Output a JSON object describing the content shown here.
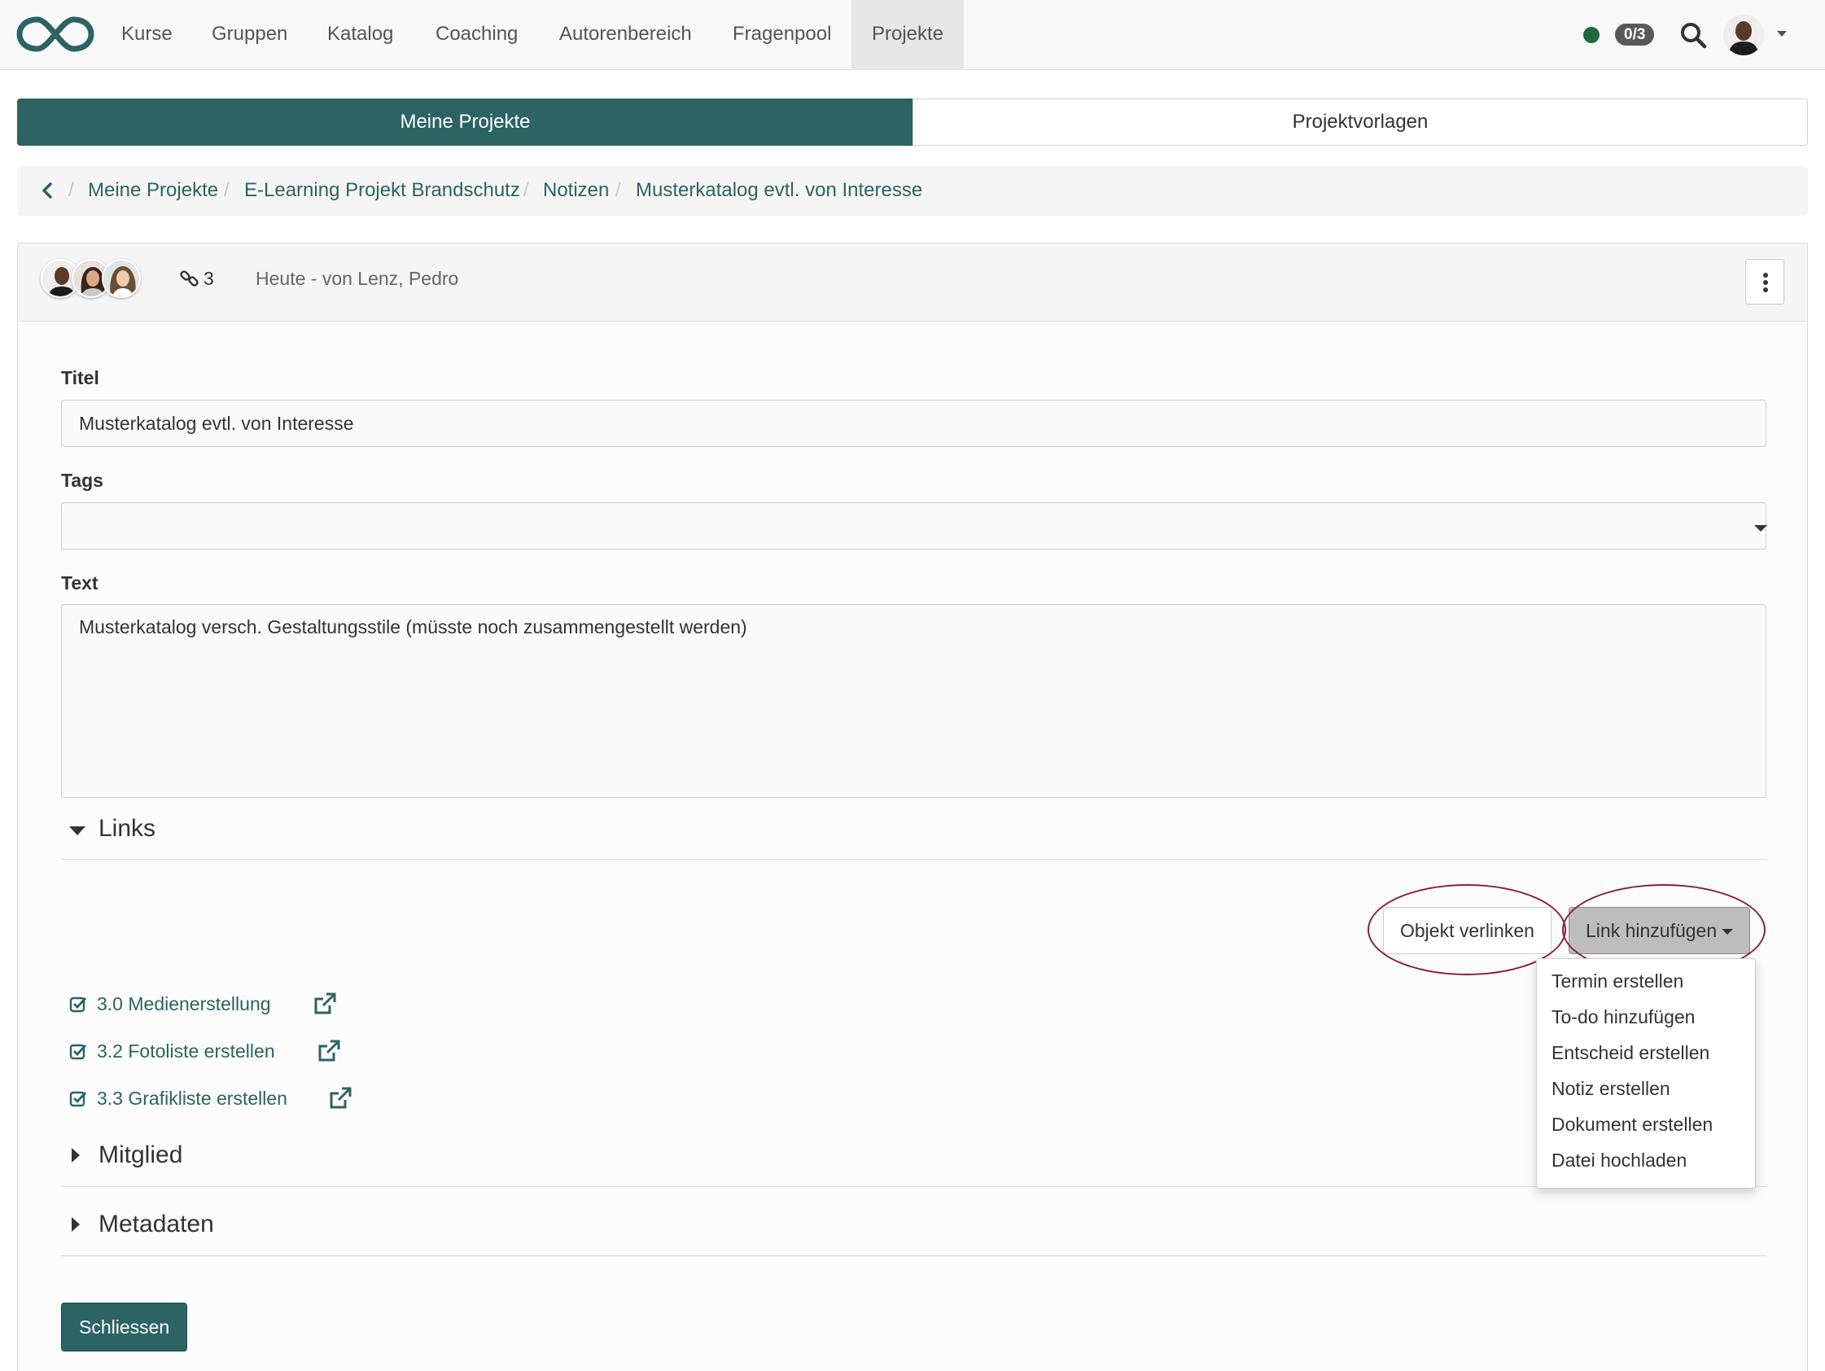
{
  "topnav": {
    "items": [
      {
        "label": "Kurse"
      },
      {
        "label": "Gruppen"
      },
      {
        "label": "Katalog"
      },
      {
        "label": "Coaching"
      },
      {
        "label": "Autorenbereich"
      },
      {
        "label": "Fragenpool"
      },
      {
        "label": "Projekte"
      }
    ],
    "active_item": "Projekte",
    "badge_count": "0/3",
    "status_color": "#1e6a3a"
  },
  "segments": {
    "my_projects": "Meine Projekte",
    "templates": "Projektvorlagen",
    "active": "Meine Projekte"
  },
  "breadcrumb": {
    "items": [
      {
        "label": "Meine Projekte"
      },
      {
        "label": "E-Learning Projekt Brandschutz"
      },
      {
        "label": "Notizen"
      },
      {
        "label": "Musterkatalog evtl. von Interesse"
      }
    ]
  },
  "header": {
    "link_count": "3",
    "meta": "Heute - von Lenz, Pedro"
  },
  "form": {
    "title_label": "Titel",
    "title_value": "Musterkatalog evtl. von Interesse",
    "tags_label": "Tags",
    "tags_value": "",
    "text_label": "Text",
    "text_value": "Musterkatalog versch. Gestaltungsstile (müsste noch zusammengestellt werden)"
  },
  "links_section": {
    "title": "Links",
    "expanded": true,
    "link_object_button": "Objekt verlinken",
    "add_link_button": "Link hinzufügen",
    "dropdown_items": [
      {
        "label": "Termin erstellen"
      },
      {
        "label": "To-do hinzufügen"
      },
      {
        "label": "Entscheid erstellen"
      },
      {
        "label": "Notiz erstellen"
      },
      {
        "label": "Dokument erstellen"
      },
      {
        "label": "Datei hochladen"
      }
    ],
    "links": [
      {
        "label": "3.0 Medienerstellung"
      },
      {
        "label": "3.2 Fotoliste erstellen"
      },
      {
        "label": "3.3 Grafikliste erstellen"
      }
    ]
  },
  "member_section": {
    "title": "Mitglied",
    "expanded": false
  },
  "metadata_section": {
    "title": "Metadaten",
    "expanded": false
  },
  "close_button": "Schliessen",
  "colors": {
    "brand": "#2c6363",
    "annotation": "#8d1e3e"
  }
}
